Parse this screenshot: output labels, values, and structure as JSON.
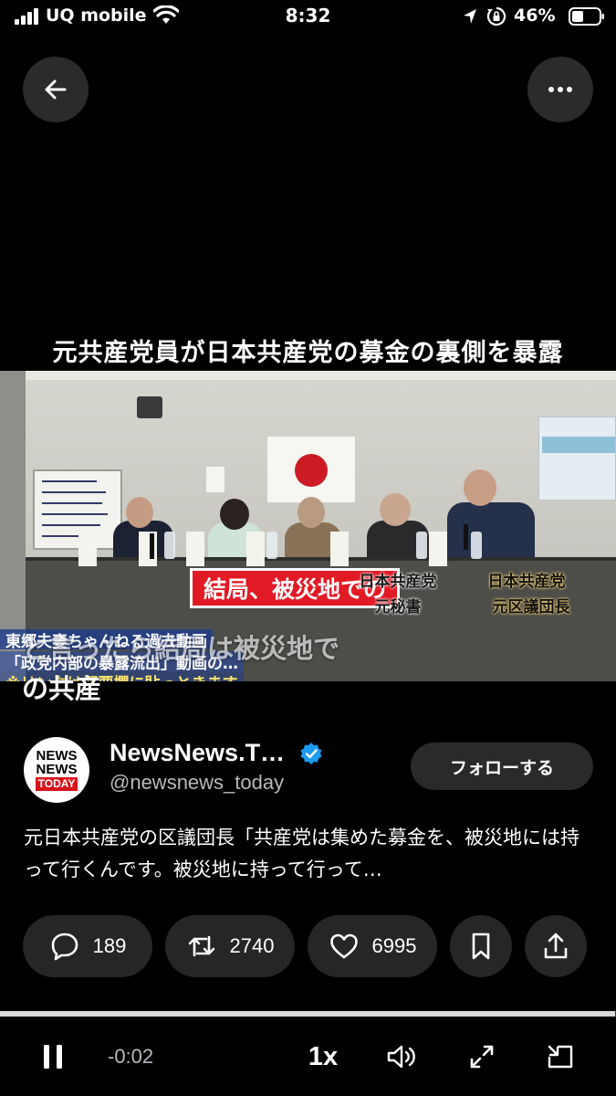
{
  "status_bar": {
    "carrier": "UQ mobile",
    "time": "8:32",
    "battery_percent": "46%",
    "icons": [
      "signal-icon",
      "wifi-icon",
      "location-arrow-icon",
      "orientation-lock-icon",
      "battery-icon"
    ]
  },
  "top_bar": {
    "back_icon": "arrow-left-icon",
    "more_icon": "more-horizontal-icon"
  },
  "video": {
    "banner_title": "元共産党員が日本共産党の募金の裏側を暴露",
    "red_caption": "結局、被災地での",
    "label_left_line1": "日本共産党",
    "label_left_line2": "元秘書",
    "label_right_line1": "日本共産党",
    "label_right_line2": "元区議団長",
    "promo_line1": "東郷夫妻ちゃんねる過去動画",
    "promo_line2": "「政党内部の暴露流出」動画の…",
    "promo_line3": "※リンクは概要欄に貼っときます",
    "subtitle_line1": "と言ったら結局は被災地で",
    "subtitle_line2": "の共産"
  },
  "author": {
    "avatar_line1": "NEWS",
    "avatar_line2": "NEWS",
    "avatar_line3": "TODAY",
    "display_name": "NewsNews.T…",
    "handle": "@newsnews_today",
    "verified": true,
    "follow_label": "フォローする"
  },
  "tweet": {
    "text": "元日本共産党の区議団長「共産党は集めた募金を、被災地には持って行くんです。被災地に持って行って…"
  },
  "actions": {
    "reply_count": "189",
    "retweet_count": "2740",
    "like_count": "6995",
    "bookmark_icon": "bookmark-icon",
    "share_icon": "share-icon"
  },
  "player": {
    "progress_fraction": 0.998,
    "time_remaining": "-0:02",
    "speed": "1x",
    "icons": [
      "pause-icon",
      "volume-icon",
      "expand-icon",
      "picture-in-picture-icon"
    ]
  },
  "colors": {
    "background": "#000000",
    "pill": "#262626",
    "verified_blue": "#1d9bf0",
    "caption_red": "#e11a25"
  }
}
